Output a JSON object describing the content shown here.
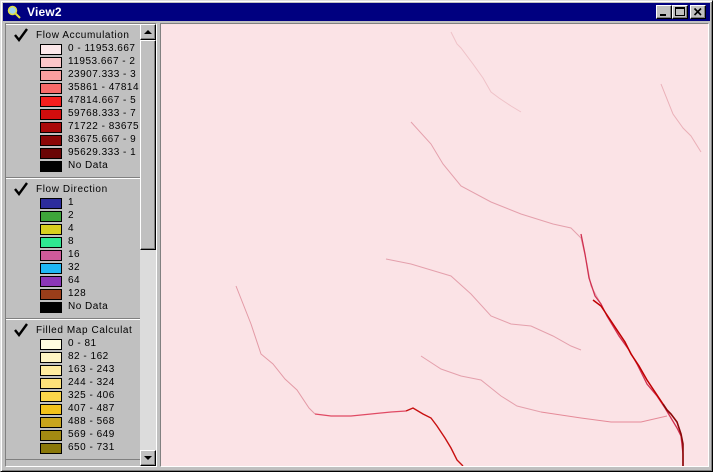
{
  "window": {
    "title": "View2",
    "icon": "view-magnifier-icon",
    "controls": [
      "minimize",
      "maximize",
      "close"
    ]
  },
  "legend": {
    "themes": [
      {
        "title": "Flow Accumulation",
        "checked": true,
        "items": [
          {
            "label": "0 - 11953.667",
            "color": "#fde8ea"
          },
          {
            "label": "11953.667 - 2",
            "color": "#fcc6c8"
          },
          {
            "label": "23907.333 - 3",
            "color": "#fb9f9f"
          },
          {
            "label": "35861 - 47814",
            "color": "#f86a69"
          },
          {
            "label": "47814.667 - 5",
            "color": "#f61e1d"
          },
          {
            "label": "59768.333 - 7",
            "color": "#d20d0d"
          },
          {
            "label": "71722 - 83675",
            "color": "#a90a0a"
          },
          {
            "label": "83675.667 - 9",
            "color": "#8a0707"
          },
          {
            "label": "95629.333 - 1",
            "color": "#6a0505"
          },
          {
            "label": "No Data",
            "color": "#000000"
          }
        ]
      },
      {
        "title": "Flow Direction",
        "checked": true,
        "items": [
          {
            "label": "1",
            "color": "#2c2c9c"
          },
          {
            "label": "2",
            "color": "#3ea53a"
          },
          {
            "label": "4",
            "color": "#d8cf1f"
          },
          {
            "label": "8",
            "color": "#2ee891"
          },
          {
            "label": "16",
            "color": "#cf5a9a"
          },
          {
            "label": "32",
            "color": "#1fb8f5"
          },
          {
            "label": "64",
            "color": "#8b36b8"
          },
          {
            "label": "128",
            "color": "#9a3e1a"
          },
          {
            "label": "No Data",
            "color": "#000000"
          }
        ]
      },
      {
        "title": "Filled Map Calculat",
        "checked": true,
        "items": [
          {
            "label": "0 - 81",
            "color": "#fffde0"
          },
          {
            "label": "82 - 162",
            "color": "#fff5c4"
          },
          {
            "label": "163 - 243",
            "color": "#ffec9f"
          },
          {
            "label": "244 - 324",
            "color": "#fee27a"
          },
          {
            "label": "325 - 406",
            "color": "#fcd64a"
          },
          {
            "label": "407 - 487",
            "color": "#f2c21a"
          },
          {
            "label": "488 - 568",
            "color": "#c9a51c"
          },
          {
            "label": "569 - 649",
            "color": "#a38a12"
          },
          {
            "label": "650 - 731",
            "color": "#8a780a"
          }
        ]
      }
    ]
  },
  "map": {
    "background_color": "#fbe3e6",
    "stream_color_light": "#e8a8b0",
    "stream_color_mid": "#d65070",
    "stream_color_dark": "#c00000"
  }
}
